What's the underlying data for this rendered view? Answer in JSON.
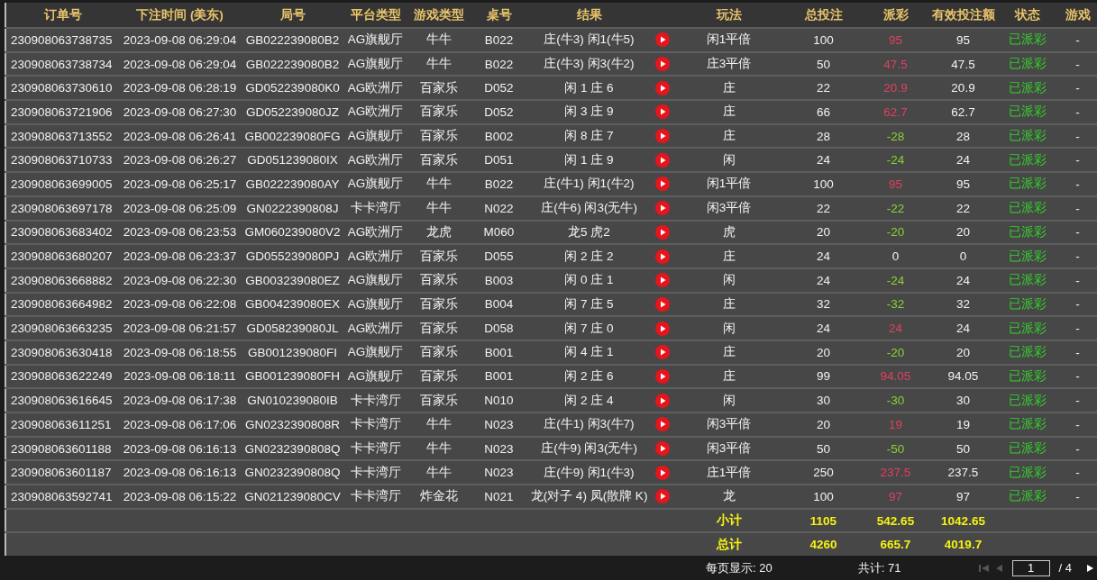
{
  "table": {
    "columns": [
      {
        "label": "订单号"
      },
      {
        "label": "下注时间 (美东)"
      },
      {
        "label": "局号"
      },
      {
        "label": "平台类型"
      },
      {
        "label": "游戏类型"
      },
      {
        "label": "桌号"
      },
      {
        "label": "结果"
      },
      {
        "label": "玩法"
      },
      {
        "label": "总投注"
      },
      {
        "label": "派彩"
      },
      {
        "label": "有效投注额"
      },
      {
        "label": "状态"
      },
      {
        "label": "游戏"
      }
    ],
    "rows": [
      {
        "order": "230908063738735",
        "time": "2023-09-08 06:29:04",
        "round": "GB022239080B2",
        "platform": "AG旗舰厅",
        "game": "牛牛",
        "table": "B022",
        "result": "庄(牛3) 闲1(牛5)",
        "play": "闲1平倍",
        "bet": "100",
        "payout": {
          "text": "95",
          "kind": "positive"
        },
        "valid": "95",
        "status": "已派彩",
        "column_13": "-"
      },
      {
        "order": "230908063738734",
        "time": "2023-09-08 06:29:04",
        "round": "GB022239080B2",
        "platform": "AG旗舰厅",
        "game": "牛牛",
        "table": "B022",
        "result": "庄(牛3) 闲3(牛2)",
        "play": "庄3平倍",
        "bet": "50",
        "payout": {
          "text": "47.5",
          "kind": "positive"
        },
        "valid": "47.5",
        "status": "已派彩",
        "column_13": "-"
      },
      {
        "order": "230908063730610",
        "time": "2023-09-08 06:28:19",
        "round": "GD052239080K0",
        "platform": "AG欧洲厅",
        "game": "百家乐",
        "table": "D052",
        "result": "闲 1 庄 6",
        "play": "庄",
        "bet": "22",
        "payout": {
          "text": "20.9",
          "kind": "positive"
        },
        "valid": "20.9",
        "status": "已派彩",
        "column_13": "-"
      },
      {
        "order": "230908063721906",
        "time": "2023-09-08 06:27:30",
        "round": "GD052239080JZ",
        "platform": "AG欧洲厅",
        "game": "百家乐",
        "table": "D052",
        "result": "闲 3 庄 9",
        "play": "庄",
        "bet": "66",
        "payout": {
          "text": "62.7",
          "kind": "positive"
        },
        "valid": "62.7",
        "status": "已派彩",
        "column_13": "-"
      },
      {
        "order": "230908063713552",
        "time": "2023-09-08 06:26:41",
        "round": "GB002239080FG",
        "platform": "AG旗舰厅",
        "game": "百家乐",
        "table": "B002",
        "result": "闲 8 庄 7",
        "play": "庄",
        "bet": "28",
        "payout": {
          "text": "-28",
          "kind": "negative"
        },
        "valid": "28",
        "status": "已派彩",
        "column_13": "-"
      },
      {
        "order": "230908063710733",
        "time": "2023-09-08 06:26:27",
        "round": "GD051239080IX",
        "platform": "AG欧洲厅",
        "game": "百家乐",
        "table": "D051",
        "result": "闲 1 庄 9",
        "play": "闲",
        "bet": "24",
        "payout": {
          "text": "-24",
          "kind": "negative"
        },
        "valid": "24",
        "status": "已派彩",
        "column_13": "-"
      },
      {
        "order": "230908063699005",
        "time": "2023-09-08 06:25:17",
        "round": "GB022239080AY",
        "platform": "AG旗舰厅",
        "game": "牛牛",
        "table": "B022",
        "result": "庄(牛1) 闲1(牛2)",
        "play": "闲1平倍",
        "bet": "100",
        "payout": {
          "text": "95",
          "kind": "positive"
        },
        "valid": "95",
        "status": "已派彩",
        "column_13": "-"
      },
      {
        "order": "230908063697178",
        "time": "2023-09-08 06:25:09",
        "round": "GN0222390808J",
        "platform": "卡卡湾厅",
        "game": "牛牛",
        "table": "N022",
        "result": "庄(牛6) 闲3(无牛)",
        "play": "闲3平倍",
        "bet": "22",
        "payout": {
          "text": "-22",
          "kind": "negative"
        },
        "valid": "22",
        "status": "已派彩",
        "column_13": "-"
      },
      {
        "order": "230908063683402",
        "time": "2023-09-08 06:23:53",
        "round": "GM060239080V2",
        "platform": "AG欧洲厅",
        "game": "龙虎",
        "table": "M060",
        "result": "龙5 虎2",
        "play": "虎",
        "bet": "20",
        "payout": {
          "text": "-20",
          "kind": "negative"
        },
        "valid": "20",
        "status": "已派彩",
        "column_13": "-"
      },
      {
        "order": "230908063680207",
        "time": "2023-09-08 06:23:37",
        "round": "GD055239080PJ",
        "platform": "AG欧洲厅",
        "game": "百家乐",
        "table": "D055",
        "result": "闲 2 庄 2",
        "play": "庄",
        "bet": "24",
        "payout": {
          "text": "0",
          "kind": "zero"
        },
        "valid": "0",
        "status": "已派彩",
        "column_13": "-"
      },
      {
        "order": "230908063668882",
        "time": "2023-09-08 06:22:30",
        "round": "GB003239080EZ",
        "platform": "AG旗舰厅",
        "game": "百家乐",
        "table": "B003",
        "result": "闲 0 庄 1",
        "play": "闲",
        "bet": "24",
        "payout": {
          "text": "-24",
          "kind": "negative"
        },
        "valid": "24",
        "status": "已派彩",
        "column_13": "-"
      },
      {
        "order": "230908063664982",
        "time": "2023-09-08 06:22:08",
        "round": "GB004239080EX",
        "platform": "AG旗舰厅",
        "game": "百家乐",
        "table": "B004",
        "result": "闲 7 庄 5",
        "play": "庄",
        "bet": "32",
        "payout": {
          "text": "-32",
          "kind": "negative"
        },
        "valid": "32",
        "status": "已派彩",
        "column_13": "-"
      },
      {
        "order": "230908063663235",
        "time": "2023-09-08 06:21:57",
        "round": "GD058239080JL",
        "platform": "AG欧洲厅",
        "game": "百家乐",
        "table": "D058",
        "result": "闲 7 庄 0",
        "play": "闲",
        "bet": "24",
        "payout": {
          "text": "24",
          "kind": "positive"
        },
        "valid": "24",
        "status": "已派彩",
        "column_13": "-"
      },
      {
        "order": "230908063630418",
        "time": "2023-09-08 06:18:55",
        "round": "GB001239080FI",
        "platform": "AG旗舰厅",
        "game": "百家乐",
        "table": "B001",
        "result": "闲 4 庄 1",
        "play": "庄",
        "bet": "20",
        "payout": {
          "text": "-20",
          "kind": "negative"
        },
        "valid": "20",
        "status": "已派彩",
        "column_13": "-"
      },
      {
        "order": "230908063622249",
        "time": "2023-09-08 06:18:11",
        "round": "GB001239080FH",
        "platform": "AG旗舰厅",
        "game": "百家乐",
        "table": "B001",
        "result": "闲 2 庄 6",
        "play": "庄",
        "bet": "99",
        "payout": {
          "text": "94.05",
          "kind": "positive"
        },
        "valid": "94.05",
        "status": "已派彩",
        "column_13": "-"
      },
      {
        "order": "230908063616645",
        "time": "2023-09-08 06:17:38",
        "round": "GN010239080IB",
        "platform": "卡卡湾厅",
        "game": "百家乐",
        "table": "N010",
        "result": "闲 2 庄 4",
        "play": "闲",
        "bet": "30",
        "payout": {
          "text": "-30",
          "kind": "negative"
        },
        "valid": "30",
        "status": "已派彩",
        "column_13": "-"
      },
      {
        "order": "230908063611251",
        "time": "2023-09-08 06:17:06",
        "round": "GN0232390808R",
        "platform": "卡卡湾厅",
        "game": "牛牛",
        "table": "N023",
        "result": "庄(牛1) 闲3(牛7)",
        "play": "闲3平倍",
        "bet": "20",
        "payout": {
          "text": "19",
          "kind": "positive"
        },
        "valid": "19",
        "status": "已派彩",
        "column_13": "-"
      },
      {
        "order": "230908063601188",
        "time": "2023-09-08 06:16:13",
        "round": "GN0232390808Q",
        "platform": "卡卡湾厅",
        "game": "牛牛",
        "table": "N023",
        "result": "庄(牛9) 闲3(无牛)",
        "play": "闲3平倍",
        "bet": "50",
        "payout": {
          "text": "-50",
          "kind": "negative"
        },
        "valid": "50",
        "status": "已派彩",
        "column_13": "-"
      },
      {
        "order": "230908063601187",
        "time": "2023-09-08 06:16:13",
        "round": "GN0232390808Q",
        "platform": "卡卡湾厅",
        "game": "牛牛",
        "table": "N023",
        "result": "庄(牛9) 闲1(牛3)",
        "play": "庄1平倍",
        "bet": "250",
        "payout": {
          "text": "237.5",
          "kind": "positive"
        },
        "valid": "237.5",
        "status": "已派彩",
        "column_13": "-"
      },
      {
        "order": "230908063592741",
        "time": "2023-09-08 06:15:22",
        "round": "GN021239080CV",
        "platform": "卡卡湾厅",
        "game": "炸金花",
        "table": "N021",
        "result": "龙(对子 4) 凤(散牌 K)",
        "play": "龙",
        "bet": "100",
        "payout": {
          "text": "97",
          "kind": "positive"
        },
        "valid": "97",
        "status": "已派彩",
        "column_13": "-"
      }
    ],
    "summary": [
      {
        "label": "小计",
        "bet": "1105",
        "payout": "542.65",
        "valid": "1042.65"
      },
      {
        "label": "总计",
        "bet": "4260",
        "payout": "665.7",
        "valid": "4019.7"
      }
    ]
  },
  "pager": {
    "page_size": "每页显示: 20",
    "total": "共计: 71",
    "page": "1",
    "pages": "/ 4",
    "nav": [
      {
        "kind": "first",
        "disabled": true
      },
      {
        "kind": "prev",
        "disabled": true
      },
      {
        "kind": "next",
        "disabled": false
      }
    ]
  }
}
